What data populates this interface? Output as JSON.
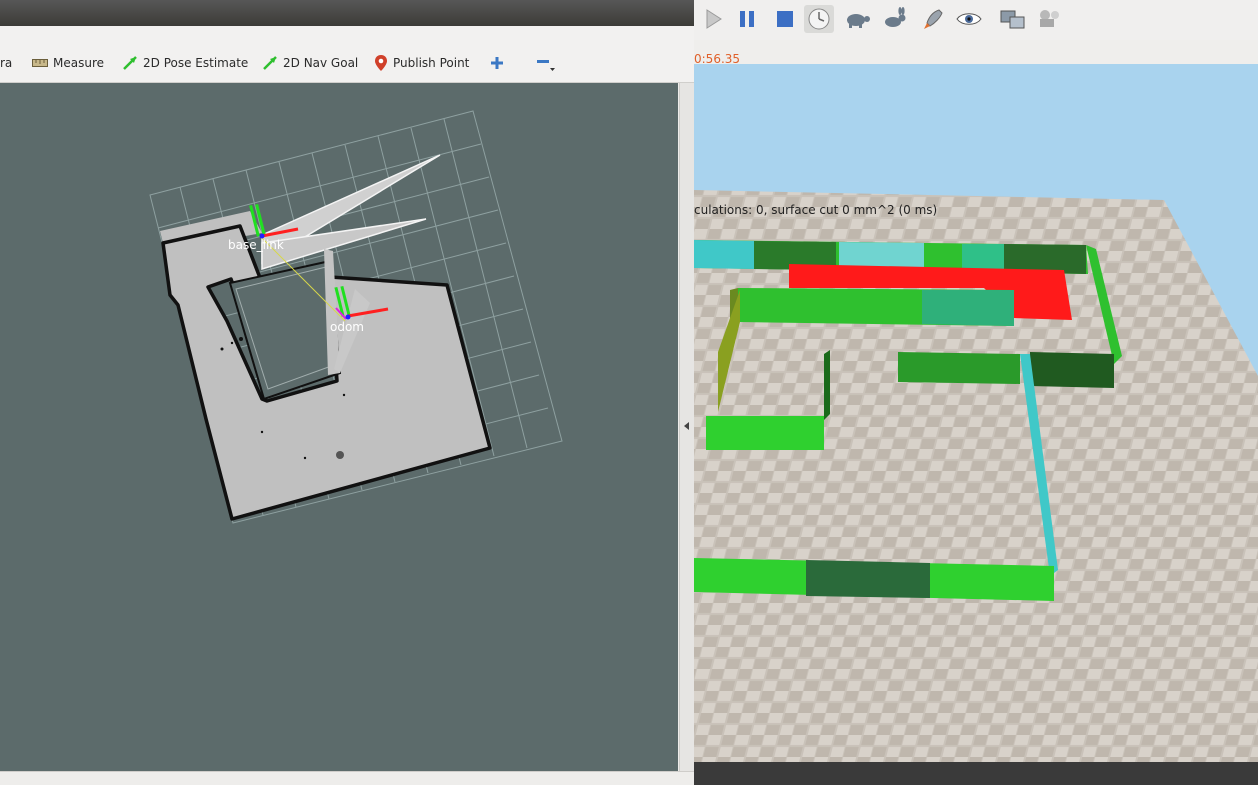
{
  "rviz": {
    "toolbar": {
      "camera_partial_label": "ra",
      "measure_label": "Measure",
      "pose_estimate_label": "2D Pose Estimate",
      "nav_goal_label": "2D Nav Goal",
      "publish_point_label": "Publish Point"
    },
    "frames": {
      "base_label": "base_link",
      "odom_label": "odom"
    },
    "colors": {
      "background": "#5c6b6b",
      "map_free": "#c0c0c0",
      "grid": "#8ea0a0"
    }
  },
  "gazebo": {
    "toolbar": {
      "icons": [
        "play-icon",
        "pause-icon",
        "stop-icon",
        "clock-icon",
        "turtle-icon",
        "rabbit-icon",
        "rocket-icon",
        "eye-icon",
        "screens-icon",
        "robot-icon"
      ]
    },
    "sim_time_partial": "0:56.35",
    "overlay_text": "culations: 0, surface cut 0 mm^2 (0 ms)",
    "colors": {
      "sky": "#a9d3ee",
      "floor": "#c9c2b9",
      "wall_green": "#2fd02f",
      "wall_cyan": "#40c8c8",
      "laser": "#ff1a1a"
    }
  }
}
